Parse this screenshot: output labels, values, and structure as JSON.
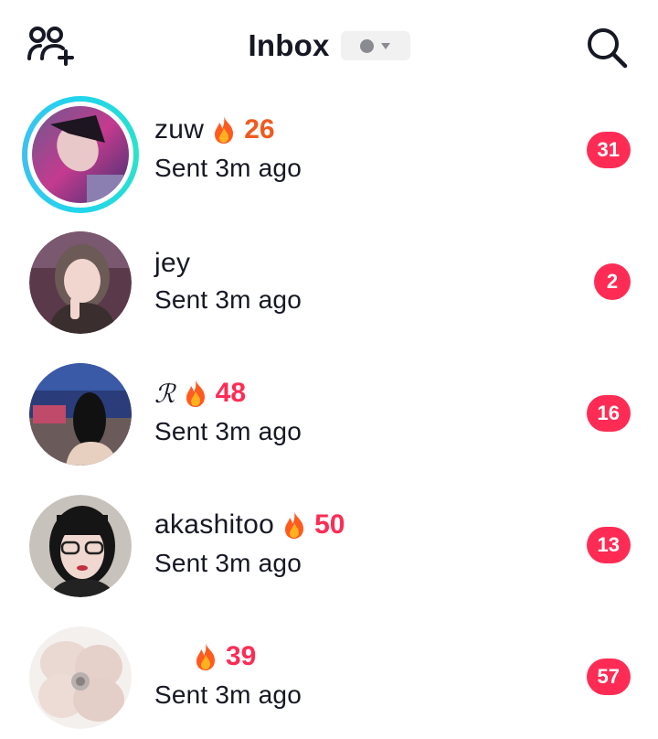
{
  "header": {
    "title": "Inbox",
    "add_friends_icon": "add-friends-icon",
    "search_icon": "search-icon",
    "status_indicator_color": "#8a8b91"
  },
  "colors": {
    "accent": "#fe2c55",
    "streak_orange": "#f05a1e",
    "story_ring": "#20d5ec"
  },
  "conversations": [
    {
      "name": "zuw",
      "streak": "26",
      "status": "Sent 3m ago",
      "unread": "31",
      "story_ring": true
    },
    {
      "name": "jey",
      "streak": "",
      "status": "Sent 3m ago",
      "unread": "2",
      "story_ring": false
    },
    {
      "name": "ℛ",
      "streak": "48",
      "status": "Sent 3m ago",
      "unread": "16",
      "story_ring": false
    },
    {
      "name": "akashitoo",
      "streak": "50",
      "status": "Sent 3m ago",
      "unread": "13",
      "story_ring": false
    },
    {
      "name": "",
      "streak": "39",
      "status": "Sent 3m ago",
      "unread": "57",
      "story_ring": false
    }
  ]
}
